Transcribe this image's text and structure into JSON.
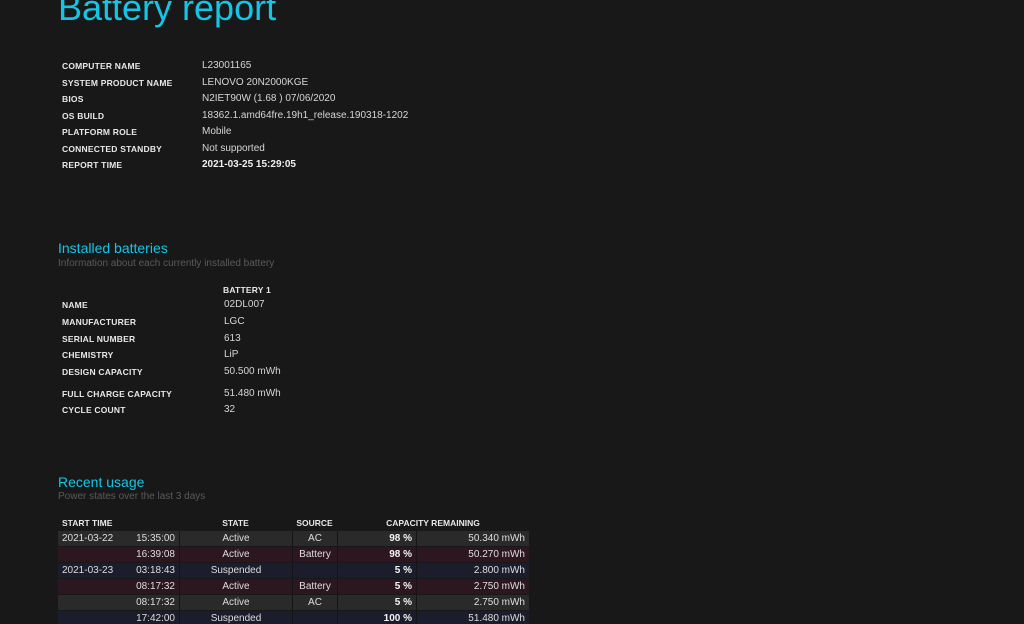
{
  "title": "Battery report",
  "system": [
    {
      "key": "COMPUTER NAME",
      "value": "L23001165"
    },
    {
      "key": "SYSTEM PRODUCT NAME",
      "value": "LENOVO 20N2000KGE"
    },
    {
      "key": "BIOS",
      "value": "N2IET90W (1.68 ) 07/06/2020"
    },
    {
      "key": "OS BUILD",
      "value": "18362.1.amd64fre.19h1_release.190318-1202"
    },
    {
      "key": "PLATFORM ROLE",
      "value": "Mobile"
    },
    {
      "key": "CONNECTED STANDBY",
      "value": "Not supported"
    },
    {
      "key": "REPORT TIME",
      "value": "2021-03-25   15:29:05"
    }
  ],
  "installed": {
    "heading": "Installed batteries",
    "subheading": "Information about each currently installed battery",
    "column": "BATTERY 1",
    "rows": [
      {
        "key": "NAME",
        "value": "02DL007"
      },
      {
        "key": "MANUFACTURER",
        "value": "LGC"
      },
      {
        "key": "SERIAL NUMBER",
        "value": "613"
      },
      {
        "key": "CHEMISTRY",
        "value": "LiP"
      },
      {
        "key": "DESIGN CAPACITY",
        "value": "50.500 mWh"
      },
      {
        "key": "FULL CHARGE CAPACITY",
        "value": "51.480 mWh"
      },
      {
        "key": "CYCLE COUNT",
        "value": "32"
      }
    ]
  },
  "usage": {
    "heading": "Recent usage",
    "subheading": "Power states over the last 3 days",
    "headers": {
      "start": "START TIME",
      "state": "STATE",
      "source": "SOURCE",
      "capacity": "CAPACITY REMAINING"
    },
    "rows": [
      {
        "date": "2021-03-22",
        "time": "15:35:00",
        "state": "Active",
        "source": "AC",
        "pct": "98 %",
        "mwh": "50.340 mWh",
        "kind": "ac"
      },
      {
        "date": "",
        "time": "16:39:08",
        "state": "Active",
        "source": "Battery",
        "pct": "98 %",
        "mwh": "50.270 mWh",
        "kind": "bat"
      },
      {
        "date": "2021-03-23",
        "time": "03:18:43",
        "state": "Suspended",
        "source": "",
        "pct": "5 %",
        "mwh": "2.800 mWh",
        "kind": "sus"
      },
      {
        "date": "",
        "time": "08:17:32",
        "state": "Active",
        "source": "Battery",
        "pct": "5 %",
        "mwh": "2.750 mWh",
        "kind": "bat"
      },
      {
        "date": "",
        "time": "08:17:32",
        "state": "Active",
        "source": "AC",
        "pct": "5 %",
        "mwh": "2.750 mWh",
        "kind": "ac"
      },
      {
        "date": "",
        "time": "17:42:00",
        "state": "Suspended",
        "source": "",
        "pct": "100 %",
        "mwh": "51.480 mWh",
        "kind": "sus"
      }
    ]
  }
}
